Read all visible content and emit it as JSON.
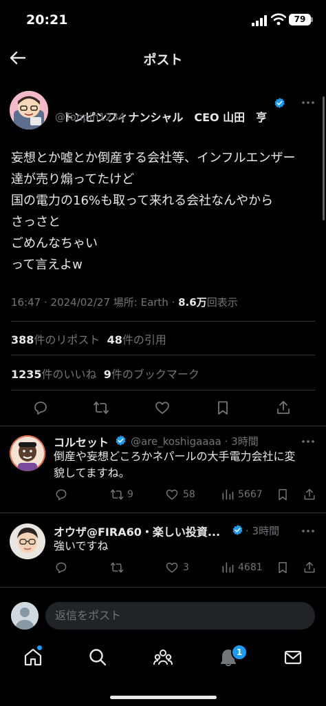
{
  "status_bar": {
    "time": "20:21",
    "battery": "79"
  },
  "header": {
    "title": "ポスト"
  },
  "post": {
    "author_name": "トンピンフィナンシャル　CEO 山田　亨",
    "author_handle": "@Tonpin1234",
    "text_lines": [
      "妄想とか嘘とか倒産する会社等、インフルエンザー",
      "達が売り煽ってたけど",
      "国の電力の16%も取って来れる会社なんやから",
      "さっさと",
      "ごめんなちゃい",
      "って言えよw"
    ],
    "meta": {
      "time_date": "16:47 · 2024/02/27 ",
      "location": "場所: Earth",
      "sep": " · ",
      "views": "8.6万",
      "views_label": "回表示"
    },
    "stats": {
      "reposts": "388",
      "reposts_label": "件のリポスト",
      "quotes": "48",
      "quotes_label": "件の引用",
      "likes": "1235",
      "likes_label": "件のいいね",
      "bookmarks": "9",
      "bookmarks_label": "件のブックマーク"
    }
  },
  "replies": [
    {
      "name": "コルセット",
      "handle": "@are_koshigaaaa",
      "time": "3時間",
      "text_lines": [
        "倒産や妄想どころかネパールの大手電力会社に変",
        "貌してますね。"
      ],
      "reposts": "9",
      "likes": "58",
      "views": "5667"
    },
    {
      "name": "オウザ@FIRA60・楽しい投資...",
      "handle": "",
      "time": "3時間",
      "text_lines": [
        "強いですね"
      ],
      "reposts": "",
      "likes": "3",
      "views": "4681"
    }
  ],
  "compose": {
    "placeholder": "返信をポスト"
  },
  "tabbar": {
    "notifications_badge": "1"
  },
  "colors": {
    "accent": "#1d9bf0",
    "background": "#000000",
    "muted": "#71767b"
  }
}
